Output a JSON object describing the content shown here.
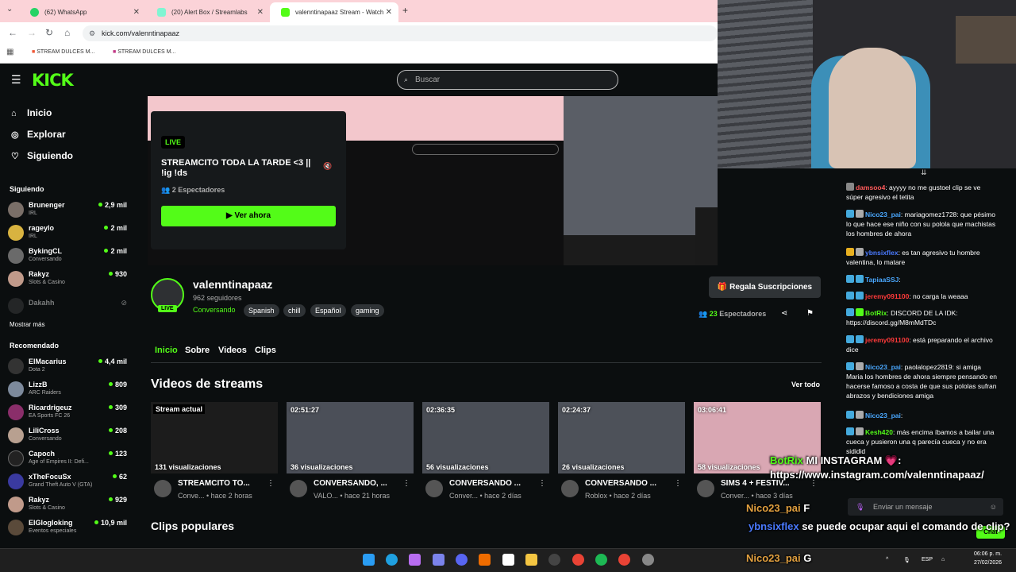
{
  "browser": {
    "tabs": [
      {
        "title": "(62) WhatsApp",
        "color": "#25d366"
      },
      {
        "title": "(20) Alert Box / Streamlabs",
        "color": "#80f5d2"
      },
      {
        "title": "valenntinapaaz Stream - Watch",
        "color": "#53fc18"
      }
    ],
    "url": "kick.com/valenntinapaaz",
    "bookmarks": [
      "STREAM DULCES M...",
      "STREAM DULCES M..."
    ]
  },
  "header": {
    "logo": "KICK",
    "search_placeholder": "Buscar"
  },
  "sidebar": {
    "nav": [
      {
        "label": "Inicio",
        "icon": "home-icon"
      },
      {
        "label": "Explorar",
        "icon": "compass-icon"
      },
      {
        "label": "Siguiendo",
        "icon": "heart-icon"
      }
    ],
    "following_title": "Siguiendo",
    "following": [
      {
        "name": "Brunenger",
        "category": "IRL",
        "viewers": "2,9 mil",
        "color": "#7a6f68"
      },
      {
        "name": "rageylo",
        "category": "IRL",
        "viewers": "2 mil",
        "color": "#d8b340"
      },
      {
        "name": "BykingCL",
        "category": "Conversando",
        "viewers": "2 mil",
        "color": "#6a6a6a"
      },
      {
        "name": "Rakyz",
        "category": "Slots & Casino",
        "viewers": "930",
        "color": "#c09a8a"
      },
      {
        "name": "Dakahh",
        "category": "",
        "viewers": "",
        "color": "#444444"
      }
    ],
    "show_more": "Mostrar más",
    "recommended_title": "Recomendado",
    "recommended": [
      {
        "name": "ElMacarius",
        "category": "Dota 2",
        "viewers": "4,4 mil",
        "color": "#333333"
      },
      {
        "name": "LizzB",
        "category": "ARC Raiders",
        "viewers": "809",
        "color": "#7d8a9c"
      },
      {
        "name": "Ricardrigeuz",
        "category": "EA Sports FC 26",
        "viewers": "309",
        "color": "#8a2e6a"
      },
      {
        "name": "LiliCross",
        "category": "Conversando",
        "viewers": "208",
        "color": "#b8a090"
      },
      {
        "name": "Capoch",
        "category": "Age of Empires II: Defi...",
        "viewers": "123",
        "color": "#222222"
      },
      {
        "name": "xTheFocuSx",
        "category": "Grand Theft Auto V (GTA)",
        "viewers": "62",
        "color": "#3a3aa0"
      },
      {
        "name": "Rakyz",
        "category": "Slots & Casino",
        "viewers": "929",
        "color": "#c09a8a"
      },
      {
        "name": "ElGlogloking",
        "category": "Eventos especiales",
        "viewers": "10,9 mil",
        "color": "#5a4a3a"
      }
    ]
  },
  "preview": {
    "live": "LIVE",
    "title": "STREAMCITO TODA LA TARDE <3 || !ig !ds",
    "viewers": "2 Espectadores",
    "watch": "Ver ahora"
  },
  "channel": {
    "name": "valenntinapaaz",
    "followers": "962 seguidores",
    "live": "LIVE",
    "category": "Conversando",
    "tags": [
      "Spanish",
      "chill",
      "Español",
      "gaming"
    ],
    "subs_button": "Regala Suscripciones",
    "viewers_count": "23",
    "viewers_label": "Espectadores"
  },
  "tabs": [
    "Inicio",
    "Sobre",
    "Videos",
    "Clips"
  ],
  "videos_section": {
    "title": "Videos de streams",
    "see_all": "Ver todo",
    "videos": [
      {
        "badge": "Stream actual",
        "views": "131 visualizaciones",
        "title": "STREAMCITO TO...",
        "meta": "Conve... • hace 2 horas",
        "bg": "#1c1c1c"
      },
      {
        "badge": "02:51:27",
        "views": "36 visualizaciones",
        "title": "CONVERSANDO, ...",
        "meta": "VALO... • hace 21 horas",
        "bg": "#4b4f58"
      },
      {
        "badge": "02:36:35",
        "views": "56 visualizaciones",
        "title": "CONVERSANDO ...",
        "meta": "Conver... • hace 2 días",
        "bg": "#4a4e56"
      },
      {
        "badge": "02:24:37",
        "views": "26 visualizaciones",
        "title": "CONVERSANDO ...",
        "meta": "Roblox • hace 2 días",
        "bg": "#4d5159"
      },
      {
        "badge": "03:06:41",
        "views": "58 visualizaciones",
        "title": "SIMS 4 + FESTIV...",
        "meta": "Conver... • hace 3 días",
        "bg": "#d9a7b3"
      }
    ]
  },
  "clips_title": "Clips populares",
  "chat": {
    "messages": [
      {
        "user": "damsoo4",
        "text": ": ayyyy no me gustoel clip se ve súper agresivo el tetita",
        "color": "#ff5a5a"
      },
      {
        "user": "Nico23_pai",
        "text": ": mariagomez1728: que pésimo lo que hace ese niño con su polola que machistas los hombres de ahora",
        "color": "#4aa8ff"
      },
      {
        "user": "ybnsixflex",
        "text": ": es tan agresivo tu hombre valentina, lo matare",
        "color": "#4a7aff"
      },
      {
        "user": "TapiaaSSJ",
        "text": ":",
        "color": "#4aa8ff"
      },
      {
        "user": "jeremy091100",
        "text": ": no carga la weaaa",
        "color": "#ff3a3a"
      },
      {
        "user": "BotRix",
        "text": ": DISCORD DE LA IDK: https://discord.gg/M8mMdTDc",
        "color": "#53fc18"
      },
      {
        "user": "jeremy091100",
        "text": ": está preparando el archivo dice",
        "color": "#ff3a3a"
      },
      {
        "user": "Nico23_pai",
        "text": ": paolalopez2819: si amiga Maria los hombres de ahora siempre pensando en hacerse famoso a costa de que sus pololas sufran abrazos y bendiciones amiga",
        "color": "#4aa8ff"
      },
      {
        "user": "Nico23_pai",
        "text": ":",
        "color": "#4aa8ff"
      },
      {
        "user": "Kesh420",
        "text": ": más encima íbamos a bailar una cueca y pusieron una q parecía cueca y no era sididid",
        "color": "#53fc18"
      }
    ],
    "input_placeholder": "Enviar un mensaje",
    "send": "Chat"
  },
  "overlay": [
    {
      "user": "BotRix",
      "text": "MI INSTAGRAM 💗: https://www.instagram.com/valenntinapaaz/",
      "color": "#53fc18"
    },
    {
      "user": "Nico23_pai",
      "text": "F",
      "color": "#e2a03f"
    },
    {
      "user": "ybnsixflex",
      "text": "se puede ocupar aqui el comando de clip?",
      "color": "#4a7aff"
    },
    {
      "user": "Nico23_pai",
      "text": "G",
      "color": "#e2a03f"
    }
  ],
  "taskbar": {
    "lang": "ESP",
    "time": "06:06 p. m.",
    "date": "27/02/2026"
  }
}
